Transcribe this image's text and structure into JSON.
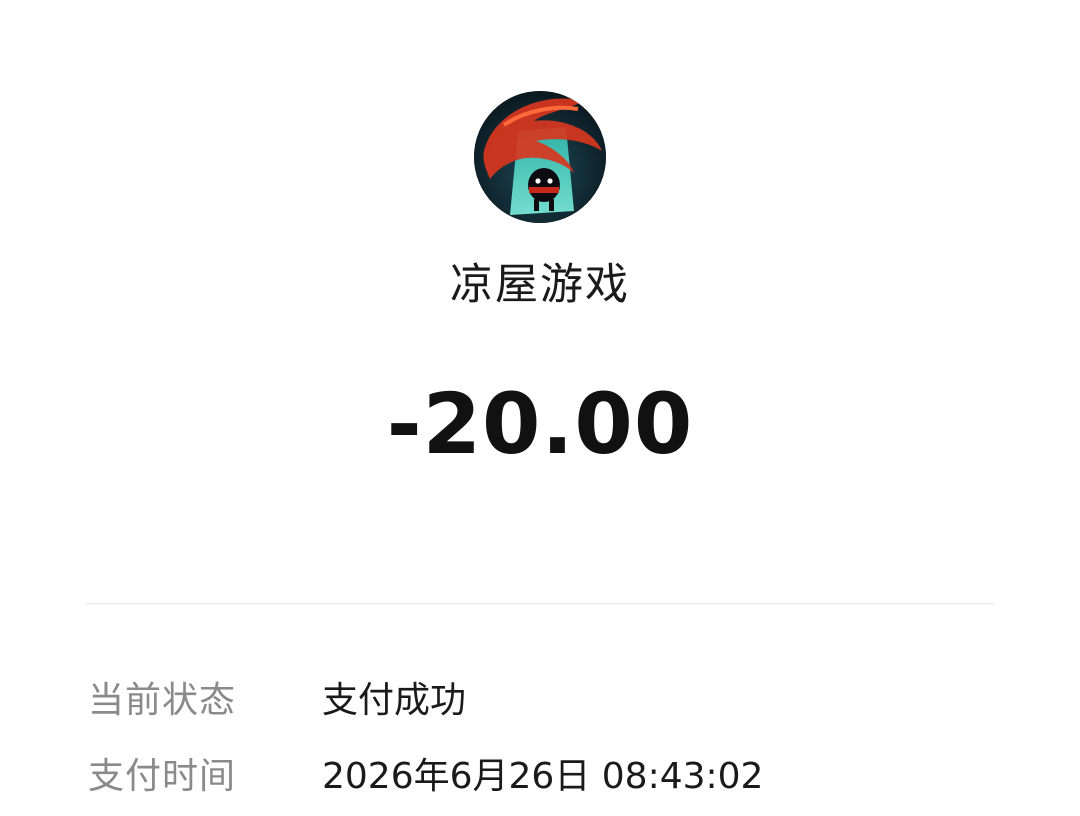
{
  "merchant": {
    "name": "凉屋游戏",
    "avatar_icon": "soul-knight-game-logo"
  },
  "amount": "-20.00",
  "details": {
    "status_label": "当前状态",
    "status_value": "支付成功",
    "time_label": "支付时间",
    "time_value": "2026年6月26日 08:43:02"
  },
  "colors": {
    "background": "#ffffff",
    "primary_text": "#1a1a1a",
    "secondary_text": "#8a8a8a",
    "divider": "#e6e6e6"
  }
}
